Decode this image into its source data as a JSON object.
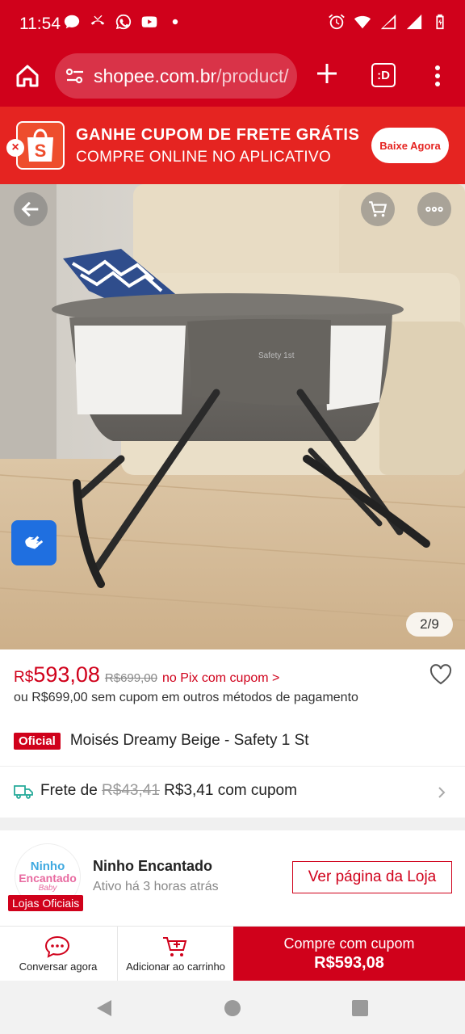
{
  "status_bar": {
    "time": "11:54"
  },
  "browser": {
    "url_domain": "shopee.com.br",
    "url_path": "/product/",
    "tabs_label": ":D"
  },
  "promo": {
    "title": "GANHE CUPOM DE FRETE GRÁTIS",
    "subtitle": "COMPRE ONLINE NO APLICATIVO",
    "button": "Baixe Agora",
    "close": "×",
    "logo_letter": "S"
  },
  "gallery": {
    "counter": "2/9",
    "brand_text": "Safety 1st"
  },
  "price": {
    "currency": "R$",
    "value": "593,08",
    "old": "R$699,00",
    "pix": "no Pix com cupom >",
    "alt": "ou R$699,00 sem cupom em outros métodos de pagamento"
  },
  "product": {
    "badge": "Oficial",
    "title": "Moisés Dreamy Beige - Safety 1 St"
  },
  "shipping": {
    "prefix": "Frete de ",
    "old": "R$43,41",
    "new": " R$3,41 com cupom"
  },
  "store": {
    "logo_line1": "Ninho",
    "logo_line2": "Encantado",
    "logo_line3": "Baby",
    "badge": "Lojas Oficiais",
    "name": "Ninho Encantado",
    "active": "Ativo há 3 horas atrás",
    "button": "Ver página da Loja"
  },
  "actions": {
    "chat": "Conversar agora",
    "cart": "Adicionar ao carrinho",
    "buy_line1": "Compre com cupom",
    "buy_line2": "R$593,08"
  },
  "colors": {
    "brand": "#d0011b",
    "promo": "#e52421",
    "accessibility": "#1f6fe0"
  }
}
